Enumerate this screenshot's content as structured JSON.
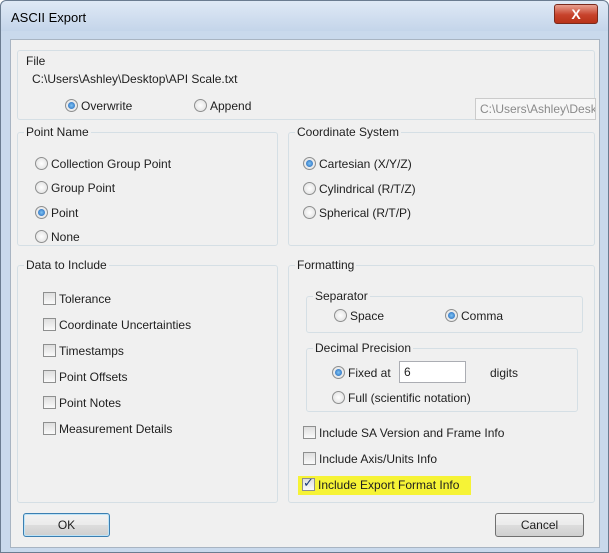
{
  "window": {
    "title": "ASCII Export",
    "close_label": "X"
  },
  "file": {
    "label": "File",
    "path": "C:\\Users\\Ashley\\Desktop\\API Scale.txt",
    "overwrite_label": "Overwrite",
    "append_label": "Append",
    "mode_selected": "Overwrite",
    "path_box_value": "C:\\Users\\Ashley\\Desk"
  },
  "point_name": {
    "label": "Point Name",
    "options": [
      "Collection Group Point",
      "Group Point",
      "Point",
      "None"
    ],
    "selected": "Point"
  },
  "coordinate_system": {
    "label": "Coordinate System",
    "options": [
      "Cartesian (X/Y/Z)",
      "Cylindrical (R/T/Z)",
      "Spherical (R/T/P)"
    ],
    "selected": "Cartesian (X/Y/Z)"
  },
  "data_to_include": {
    "label": "Data to Include",
    "items": [
      "Tolerance",
      "Coordinate Uncertainties",
      "Timestamps",
      "Point Offsets",
      "Point Notes",
      "Measurement Details"
    ],
    "checked": []
  },
  "formatting": {
    "label": "Formatting",
    "separator": {
      "label": "Separator",
      "space_label": "Space",
      "comma_label": "Comma",
      "selected": "Comma"
    },
    "decimal_precision": {
      "label": "Decimal Precision",
      "fixed_label": "Fixed at",
      "fixed_value": "6",
      "digits_label": "digits",
      "full_label": "Full (scientific notation)",
      "selected": "Fixed at"
    },
    "include_sa_version_label": "Include SA Version and Frame Info",
    "include_sa_version_checked": false,
    "include_axis_units_label": "Include Axis/Units Info",
    "include_axis_units_checked": false,
    "include_export_format_label": "Include Export Format Info",
    "include_export_format_checked": true,
    "highlight_color": "#f6f336"
  },
  "buttons": {
    "ok_label": "OK",
    "cancel_label": "Cancel"
  }
}
